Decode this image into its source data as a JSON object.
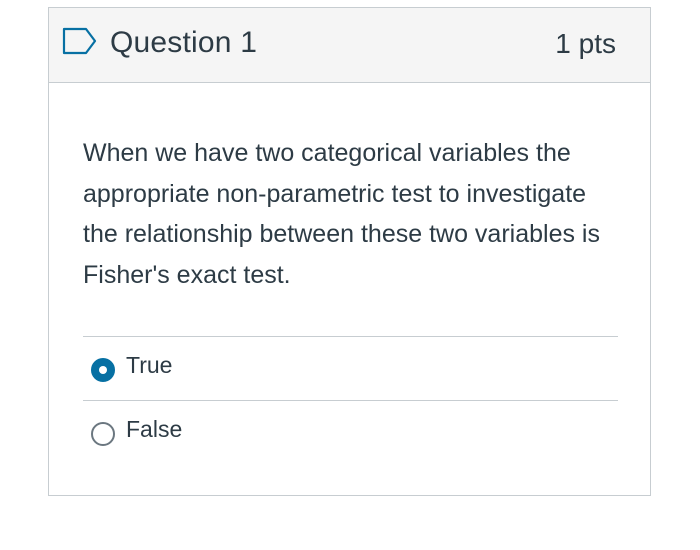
{
  "question": {
    "title": "Question 1",
    "points": "1 pts",
    "text": "When we have two categorical variables the appropriate non-parametric test to investigate the relationship between these two variables is Fisher's exact test.",
    "flag_icon": "flag-outline-icon"
  },
  "answers": [
    {
      "label": "True",
      "selected": true
    },
    {
      "label": "False",
      "selected": false
    }
  ],
  "colors": {
    "accent": "#0770a3",
    "text": "#2d3b45",
    "header_bg": "#f5f5f5",
    "border": "#c7cdd1"
  }
}
